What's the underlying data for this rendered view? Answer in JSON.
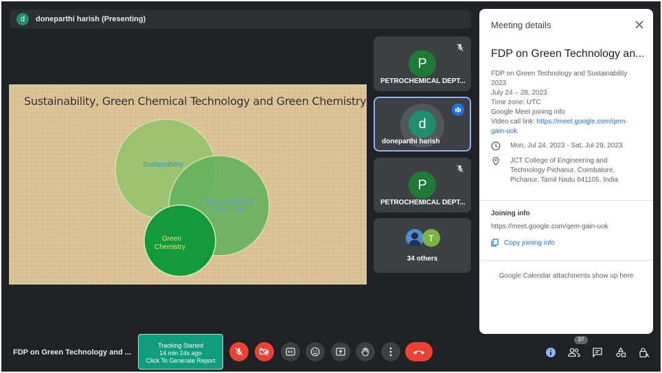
{
  "presenter": {
    "avatar_letter": "d",
    "label": "doneparthi harish (Presenting)"
  },
  "slide": {
    "title": "Sustainability, Green Chemical Technology and Green Chemistry",
    "circles": [
      "Sustainability",
      "Green Chemical",
      "Technology",
      "Green",
      "Chemistry"
    ]
  },
  "tiles": [
    {
      "letter": "P",
      "name": "PETROCHEMICAL DEPT...",
      "color": "#1e7b34"
    },
    {
      "letter": "d",
      "name": "doneparthi harish",
      "color": "#1e8e6e"
    },
    {
      "letter": "P",
      "name": "PETROCHEMICAL DEPT...",
      "color": "#1e7b34"
    },
    {
      "others_avatar_letter": "T",
      "others_label": "34 others"
    }
  ],
  "details": {
    "header": "Meeting details",
    "title": "FDP on Green Technology an...",
    "lines": [
      "FDP on Green Technology and Sustainability",
      "2023",
      "July 24 – 28, 2023",
      "Time zone: UTC",
      "Google Meet joining info",
      "Video call link: "
    ],
    "video_link": "https://meet.google.com/qem-",
    "video_link_2": "gain-uok",
    "date_range": "Mon, Jul 24, 2023 - Sat, Jul 29, 2023",
    "location": [
      "JCT College of Engineering and",
      "Technology Pichanur, Coimbatore,",
      "Pichanur, Tamil Nadu 641105, India"
    ],
    "joining_label": "Joining info",
    "joining_url": "https://meet.google.com/qem-gain-uok",
    "copy_label": "Copy joining info",
    "attachments_note": "Google Calendar attachments show up here"
  },
  "bottom": {
    "meeting_name": "FDP on Green Technology and ...",
    "tracking": [
      "Tracking Started",
      "14 min 24s ago",
      "Click To Generate Report"
    ],
    "people_count": "37"
  }
}
